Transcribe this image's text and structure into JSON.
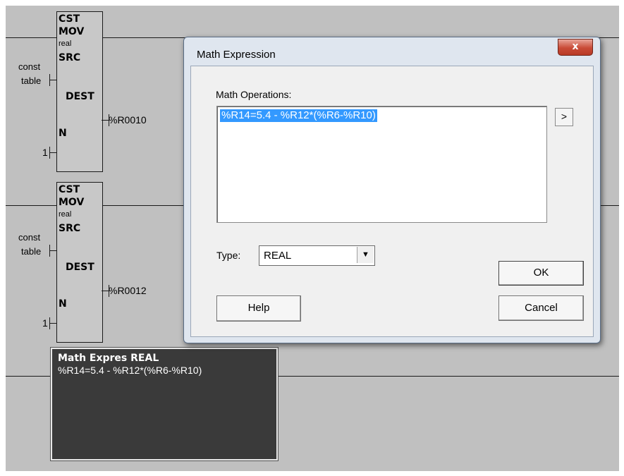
{
  "ladder": {
    "block1": {
      "func": "CST",
      "op": "MOV",
      "dtype": "real",
      "src_pin": "SRC",
      "dest_pin": "DEST",
      "n_pin": "N",
      "src_input_line1": "const",
      "src_input_line2": "table",
      "dest_output": "%R0010",
      "n_input": "1"
    },
    "block2": {
      "func": "CST",
      "op": "MOV",
      "dtype": "real",
      "src_pin": "SRC",
      "dest_pin": "DEST",
      "n_pin": "N",
      "src_input_line1": "const",
      "src_input_line2": "table",
      "dest_output": "%R0012",
      "n_input": "1"
    },
    "math_block": {
      "title": "Math Expres REAL",
      "expression": "%R14=5.4 - %R12*(%R6-%R10)"
    }
  },
  "dialog": {
    "title": "Math Expression",
    "close_label": "x",
    "operations_label": "Math Operations:",
    "operations_value": "%R14=5.4 - %R12*(%R6-%R10)",
    "arrow_label": ">",
    "type_label": "Type:",
    "type_value": "REAL",
    "ok_label": "OK",
    "cancel_label": "Cancel",
    "help_label": "Help"
  },
  "colors": {
    "canvas": "#c0c0c0",
    "selection": "#3399ff",
    "math_block_bg": "#3a3a3a",
    "close_button": "#c94a36"
  }
}
